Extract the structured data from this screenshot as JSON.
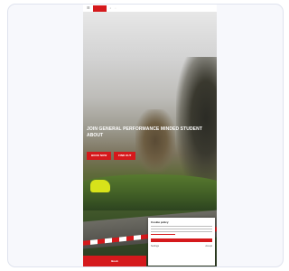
{
  "topbar": {
    "menu_icon": "menu-icon",
    "logo_text": "",
    "search_icon": "search-icon",
    "extra_icon": "user-icon"
  },
  "hero": {
    "title": "JOIN GENERAL PERFORMANCE MINDED STUDENT ABOUT",
    "primary_button": "BOOK NOW",
    "secondary_button": "FIND OUT"
  },
  "cookie_banner": {
    "title": "Cookie policy",
    "accept_label": "",
    "link_left": "Settings",
    "link_right": "Accept"
  },
  "bottom_cta": {
    "label": "Book"
  },
  "colors": {
    "brand_red": "#d5191c",
    "card_bg": "#f7f8fc",
    "card_border": "#dfe3ee"
  }
}
